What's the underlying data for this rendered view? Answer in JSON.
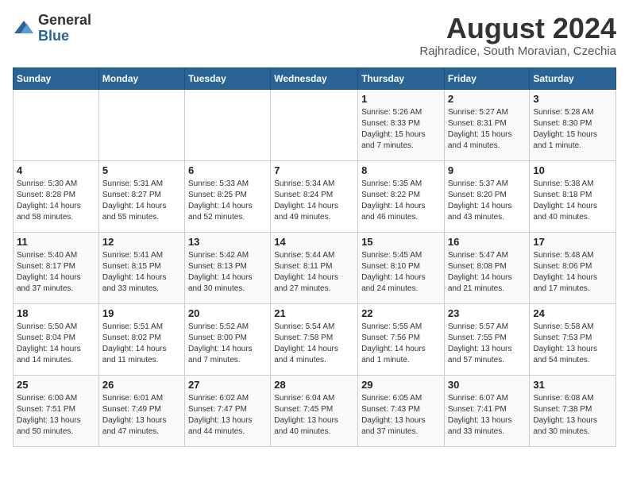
{
  "header": {
    "logo_general": "General",
    "logo_blue": "Blue",
    "month_year": "August 2024",
    "location": "Rajhradice, South Moravian, Czechia"
  },
  "weekdays": [
    "Sunday",
    "Monday",
    "Tuesday",
    "Wednesday",
    "Thursday",
    "Friday",
    "Saturday"
  ],
  "weeks": [
    [
      {
        "day": "",
        "info": ""
      },
      {
        "day": "",
        "info": ""
      },
      {
        "day": "",
        "info": ""
      },
      {
        "day": "",
        "info": ""
      },
      {
        "day": "1",
        "info": "Sunrise: 5:26 AM\nSunset: 8:33 PM\nDaylight: 15 hours\nand 7 minutes."
      },
      {
        "day": "2",
        "info": "Sunrise: 5:27 AM\nSunset: 8:31 PM\nDaylight: 15 hours\nand 4 minutes."
      },
      {
        "day": "3",
        "info": "Sunrise: 5:28 AM\nSunset: 8:30 PM\nDaylight: 15 hours\nand 1 minute."
      }
    ],
    [
      {
        "day": "4",
        "info": "Sunrise: 5:30 AM\nSunset: 8:28 PM\nDaylight: 14 hours\nand 58 minutes."
      },
      {
        "day": "5",
        "info": "Sunrise: 5:31 AM\nSunset: 8:27 PM\nDaylight: 14 hours\nand 55 minutes."
      },
      {
        "day": "6",
        "info": "Sunrise: 5:33 AM\nSunset: 8:25 PM\nDaylight: 14 hours\nand 52 minutes."
      },
      {
        "day": "7",
        "info": "Sunrise: 5:34 AM\nSunset: 8:24 PM\nDaylight: 14 hours\nand 49 minutes."
      },
      {
        "day": "8",
        "info": "Sunrise: 5:35 AM\nSunset: 8:22 PM\nDaylight: 14 hours\nand 46 minutes."
      },
      {
        "day": "9",
        "info": "Sunrise: 5:37 AM\nSunset: 8:20 PM\nDaylight: 14 hours\nand 43 minutes."
      },
      {
        "day": "10",
        "info": "Sunrise: 5:38 AM\nSunset: 8:18 PM\nDaylight: 14 hours\nand 40 minutes."
      }
    ],
    [
      {
        "day": "11",
        "info": "Sunrise: 5:40 AM\nSunset: 8:17 PM\nDaylight: 14 hours\nand 37 minutes."
      },
      {
        "day": "12",
        "info": "Sunrise: 5:41 AM\nSunset: 8:15 PM\nDaylight: 14 hours\nand 33 minutes."
      },
      {
        "day": "13",
        "info": "Sunrise: 5:42 AM\nSunset: 8:13 PM\nDaylight: 14 hours\nand 30 minutes."
      },
      {
        "day": "14",
        "info": "Sunrise: 5:44 AM\nSunset: 8:11 PM\nDaylight: 14 hours\nand 27 minutes."
      },
      {
        "day": "15",
        "info": "Sunrise: 5:45 AM\nSunset: 8:10 PM\nDaylight: 14 hours\nand 24 minutes."
      },
      {
        "day": "16",
        "info": "Sunrise: 5:47 AM\nSunset: 8:08 PM\nDaylight: 14 hours\nand 21 minutes."
      },
      {
        "day": "17",
        "info": "Sunrise: 5:48 AM\nSunset: 8:06 PM\nDaylight: 14 hours\nand 17 minutes."
      }
    ],
    [
      {
        "day": "18",
        "info": "Sunrise: 5:50 AM\nSunset: 8:04 PM\nDaylight: 14 hours\nand 14 minutes."
      },
      {
        "day": "19",
        "info": "Sunrise: 5:51 AM\nSunset: 8:02 PM\nDaylight: 14 hours\nand 11 minutes."
      },
      {
        "day": "20",
        "info": "Sunrise: 5:52 AM\nSunset: 8:00 PM\nDaylight: 14 hours\nand 7 minutes."
      },
      {
        "day": "21",
        "info": "Sunrise: 5:54 AM\nSunset: 7:58 PM\nDaylight: 14 hours\nand 4 minutes."
      },
      {
        "day": "22",
        "info": "Sunrise: 5:55 AM\nSunset: 7:56 PM\nDaylight: 14 hours\nand 1 minute."
      },
      {
        "day": "23",
        "info": "Sunrise: 5:57 AM\nSunset: 7:55 PM\nDaylight: 13 hours\nand 57 minutes."
      },
      {
        "day": "24",
        "info": "Sunrise: 5:58 AM\nSunset: 7:53 PM\nDaylight: 13 hours\nand 54 minutes."
      }
    ],
    [
      {
        "day": "25",
        "info": "Sunrise: 6:00 AM\nSunset: 7:51 PM\nDaylight: 13 hours\nand 50 minutes."
      },
      {
        "day": "26",
        "info": "Sunrise: 6:01 AM\nSunset: 7:49 PM\nDaylight: 13 hours\nand 47 minutes."
      },
      {
        "day": "27",
        "info": "Sunrise: 6:02 AM\nSunset: 7:47 PM\nDaylight: 13 hours\nand 44 minutes."
      },
      {
        "day": "28",
        "info": "Sunrise: 6:04 AM\nSunset: 7:45 PM\nDaylight: 13 hours\nand 40 minutes."
      },
      {
        "day": "29",
        "info": "Sunrise: 6:05 AM\nSunset: 7:43 PM\nDaylight: 13 hours\nand 37 minutes."
      },
      {
        "day": "30",
        "info": "Sunrise: 6:07 AM\nSunset: 7:41 PM\nDaylight: 13 hours\nand 33 minutes."
      },
      {
        "day": "31",
        "info": "Sunrise: 6:08 AM\nSunset: 7:38 PM\nDaylight: 13 hours\nand 30 minutes."
      }
    ]
  ]
}
